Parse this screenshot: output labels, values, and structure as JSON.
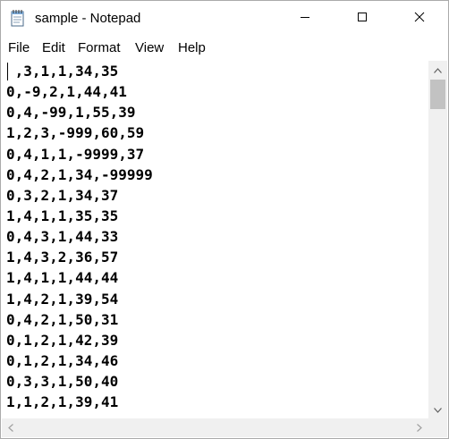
{
  "window": {
    "title": "sample - Notepad"
  },
  "app_icon": "notepad-icon",
  "title_controls": {
    "minimize": "minimize-icon",
    "maximize": "maximize-icon",
    "close": "close-icon"
  },
  "menu": [
    {
      "label": "File"
    },
    {
      "label": "Edit"
    },
    {
      "label": "Format"
    },
    {
      "label": "View"
    },
    {
      "label": "Help"
    }
  ],
  "editor": {
    "lines": [
      " ,3,1,1,34,35",
      "0,-9,2,1,44,41",
      "0,4,-99,1,55,39",
      "1,2,3,-999,60,59",
      "0,4,1,1,-9999,37",
      "0,4,2,1,34,-99999",
      "0,3,2,1,34,37",
      "1,4,1,1,35,35",
      "0,4,3,1,44,33",
      "1,4,3,2,36,57",
      "1,4,1,1,44,44",
      "1,4,2,1,39,54",
      "0,4,2,1,50,31",
      "0,1,2,1,42,39",
      "0,1,2,1,34,46",
      "0,3,3,1,50,40",
      "1,1,2,1,39,41"
    ]
  },
  "colors": {
    "scrollbar_track": "#f0f0f0",
    "scrollbar_thumb": "#c2c2c2",
    "window_border": "#aaaaaa"
  }
}
